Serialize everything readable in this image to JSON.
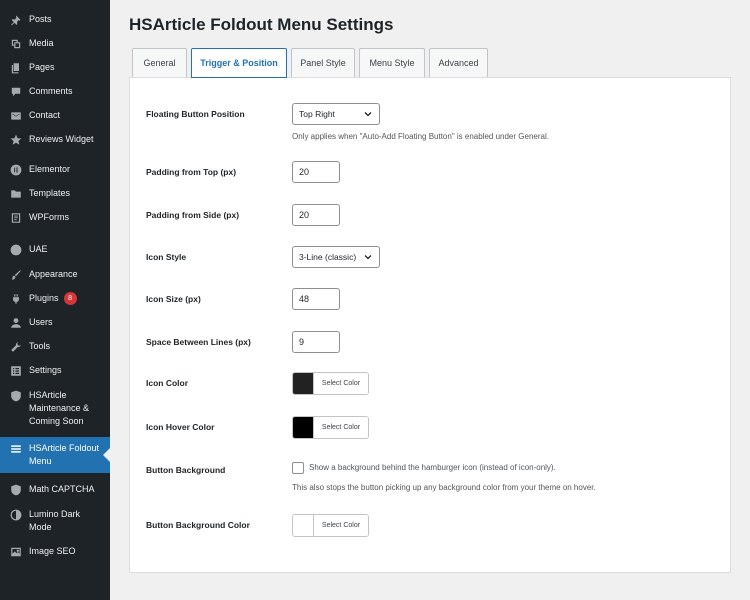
{
  "sidebar": {
    "items": [
      {
        "label": "Posts",
        "icon": "pin-icon"
      },
      {
        "label": "Media",
        "icon": "media-icon"
      },
      {
        "label": "Pages",
        "icon": "pages-icon"
      },
      {
        "label": "Comments",
        "icon": "comments-icon"
      },
      {
        "label": "Contact",
        "icon": "contact-icon"
      },
      {
        "label": "Reviews Widget",
        "icon": "star-icon"
      },
      {
        "label": "Elementor",
        "icon": "elementor-icon"
      },
      {
        "label": "Templates",
        "icon": "folder-icon"
      },
      {
        "label": "WPForms",
        "icon": "forms-icon"
      },
      {
        "label": "UAE",
        "icon": "uae-icon"
      },
      {
        "label": "Appearance",
        "icon": "brush-icon"
      },
      {
        "label": "Plugins",
        "icon": "plugin-icon",
        "badge": "8"
      },
      {
        "label": "Users",
        "icon": "user-icon"
      },
      {
        "label": "Tools",
        "icon": "wrench-icon"
      },
      {
        "label": "Settings",
        "icon": "settings-icon"
      },
      {
        "label": "HSArticle Maintenance & Coming Soon",
        "icon": "shield-icon"
      },
      {
        "label": "HSArticle Foldout Menu",
        "icon": "hamburger-icon",
        "active": true
      },
      {
        "label": "Math CAPTCHA",
        "icon": "shield-icon"
      },
      {
        "label": "Lumino Dark Mode",
        "icon": "moon-icon"
      },
      {
        "label": "Image SEO",
        "icon": "image-icon"
      }
    ]
  },
  "page": {
    "title": "HSArticle Foldout Menu Settings"
  },
  "tabs": [
    {
      "label": "General"
    },
    {
      "label": "Trigger & Position",
      "active": true
    },
    {
      "label": "Panel Style"
    },
    {
      "label": "Menu Style"
    },
    {
      "label": "Advanced"
    }
  ],
  "settings": {
    "floating_position": {
      "label": "Floating Button Position",
      "value": "Top Right",
      "description": "Only applies when \"Auto-Add Floating Button\" is enabled under General."
    },
    "padding_top": {
      "label": "Padding from Top (px)",
      "value": "20"
    },
    "padding_side": {
      "label": "Padding from Side (px)",
      "value": "20"
    },
    "icon_style": {
      "label": "Icon Style",
      "value": "3-Line (classic)"
    },
    "icon_size": {
      "label": "Icon Size (px)",
      "value": "48"
    },
    "line_spacing": {
      "label": "Space Between Lines (px)",
      "value": "9"
    },
    "icon_color": {
      "label": "Icon Color",
      "button": "Select Color",
      "color": "#222222"
    },
    "icon_hover_color": {
      "label": "Icon Hover Color",
      "button": "Select Color",
      "color": "#000000"
    },
    "button_background": {
      "label": "Button Background",
      "checkbox_label": "Show a background behind the hamburger icon (instead of icon-only).",
      "checked": false,
      "description": "This also stops the button picking up any background color from your theme on hover."
    },
    "button_background_color": {
      "label": "Button Background Color",
      "button": "Select Color",
      "color": "#ffffff"
    }
  },
  "colors": {
    "sidebar_bg": "#1d2327",
    "accent": "#2271b1",
    "badge": "#d63638"
  }
}
